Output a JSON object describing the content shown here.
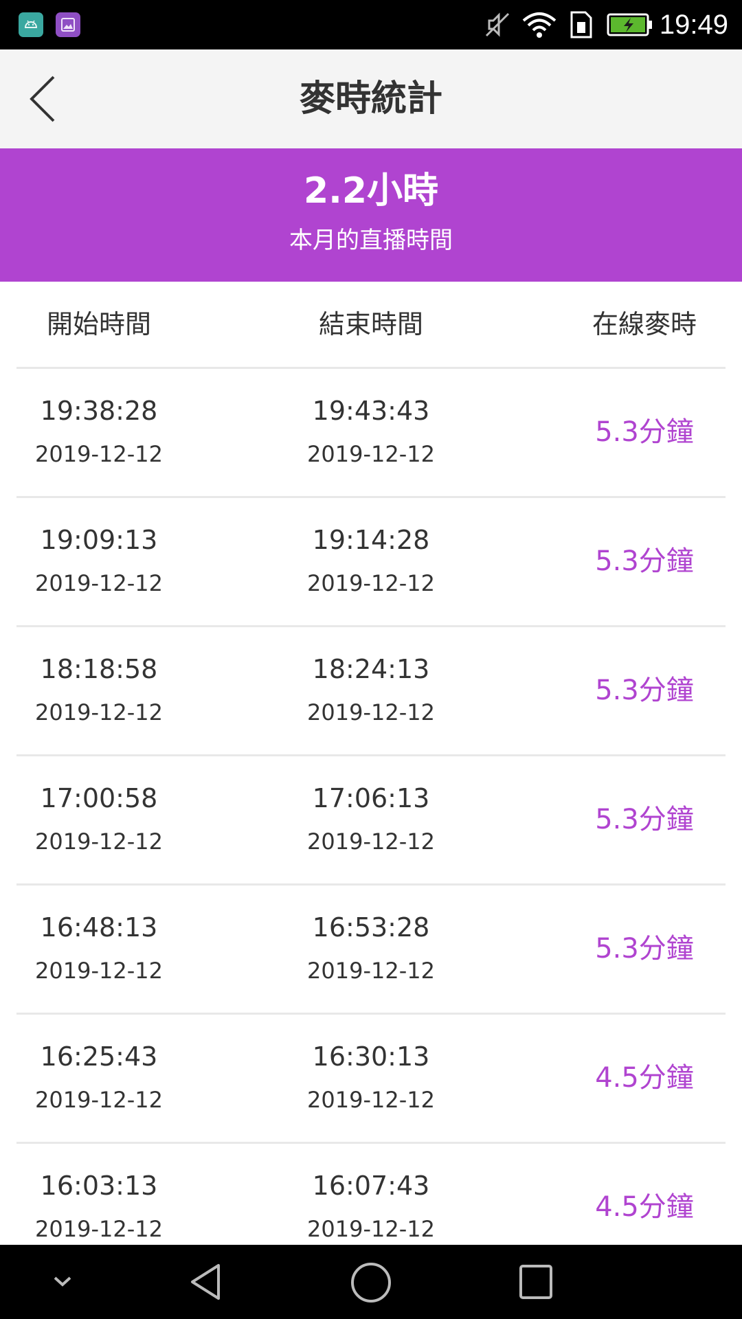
{
  "status_bar": {
    "time": "19:49",
    "icons": [
      "android-app-icon",
      "gallery-app-icon",
      "mute-icon",
      "wifi-icon",
      "sim-icon",
      "battery-charging-icon"
    ]
  },
  "app_bar": {
    "title": "麥時統計",
    "back_icon": "chevron-left-icon"
  },
  "summary": {
    "value": "2.2小時",
    "label": "本月的直播時間",
    "accent_color": "#b044d0"
  },
  "table": {
    "headers": [
      "開始時間",
      "結束時間",
      "在線麥時"
    ],
    "rows": [
      {
        "start_time": "19:38:28",
        "start_date": "2019-12-12",
        "end_time": "19:43:43",
        "end_date": "2019-12-12",
        "duration": "5.3分鐘"
      },
      {
        "start_time": "19:09:13",
        "start_date": "2019-12-12",
        "end_time": "19:14:28",
        "end_date": "2019-12-12",
        "duration": "5.3分鐘"
      },
      {
        "start_time": "18:18:58",
        "start_date": "2019-12-12",
        "end_time": "18:24:13",
        "end_date": "2019-12-12",
        "duration": "5.3分鐘"
      },
      {
        "start_time": "17:00:58",
        "start_date": "2019-12-12",
        "end_time": "17:06:13",
        "end_date": "2019-12-12",
        "duration": "5.3分鐘"
      },
      {
        "start_time": "16:48:13",
        "start_date": "2019-12-12",
        "end_time": "16:53:28",
        "end_date": "2019-12-12",
        "duration": "5.3分鐘"
      },
      {
        "start_time": "16:25:43",
        "start_date": "2019-12-12",
        "end_time": "16:30:13",
        "end_date": "2019-12-12",
        "duration": "4.5分鐘"
      },
      {
        "start_time": "16:03:13",
        "start_date": "2019-12-12",
        "end_time": "16:07:43",
        "end_date": "2019-12-12",
        "duration": "4.5分鐘"
      }
    ]
  },
  "nav_bar": {
    "icons": [
      "collapse-chevron-icon",
      "back-triangle-icon",
      "home-circle-icon",
      "recents-square-icon"
    ]
  }
}
